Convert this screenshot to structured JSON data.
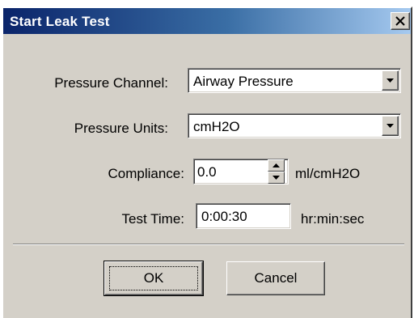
{
  "window": {
    "title": "Start Leak Test",
    "close_icon": "close-icon"
  },
  "fields": {
    "pressure_channel": {
      "label": "Pressure Channel:",
      "value": "Airway Pressure"
    },
    "pressure_units": {
      "label": "Pressure Units:",
      "value": "cmH2O"
    },
    "compliance": {
      "label": "Compliance:",
      "value": "0.0",
      "unit": "ml/cmH2O"
    },
    "test_time": {
      "label": "Test Time:",
      "value": "0:00:30",
      "unit": "hr:min:sec"
    }
  },
  "buttons": {
    "ok": "OK",
    "cancel": "Cancel"
  },
  "colors": {
    "titlebar_start": "#0a246a",
    "titlebar_end": "#a6caf0",
    "face": "#d4d0c8"
  }
}
